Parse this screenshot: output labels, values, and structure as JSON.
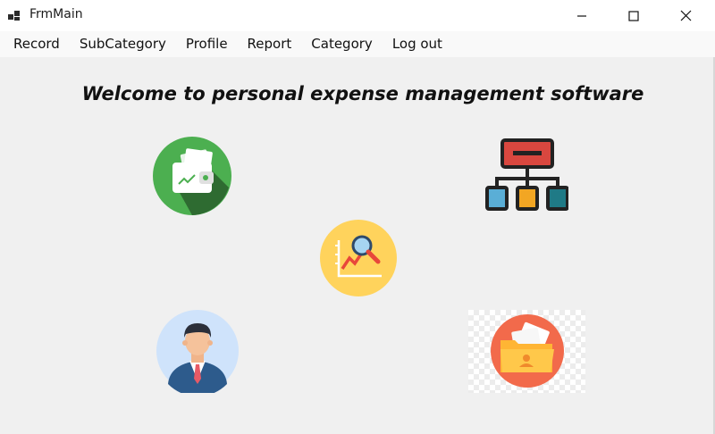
{
  "window": {
    "title": "FrmMain",
    "app_icon": "windows-app-icon",
    "controls": [
      "minimize-icon",
      "maximize-icon",
      "close-icon"
    ]
  },
  "menu": {
    "items": [
      {
        "label": "Record"
      },
      {
        "label": "SubCategory"
      },
      {
        "label": "Profile"
      },
      {
        "label": "Report"
      },
      {
        "label": "Category"
      },
      {
        "label": "Log out"
      }
    ]
  },
  "main": {
    "welcome": "Welcome to personal expense management software",
    "tiles": [
      {
        "icon": "wallet-icon"
      },
      {
        "icon": "category-hierarchy-icon"
      },
      {
        "icon": "report-chart-icon"
      },
      {
        "icon": "profile-user-icon"
      },
      {
        "icon": "folder-icon"
      }
    ]
  },
  "colors": {
    "background": "#f0f0f0",
    "wallet_green": "#4caf50",
    "report_yellow": "#ffd35c",
    "profile_blue": "#cfe3fb",
    "folder_orange": "#f26a4b"
  }
}
